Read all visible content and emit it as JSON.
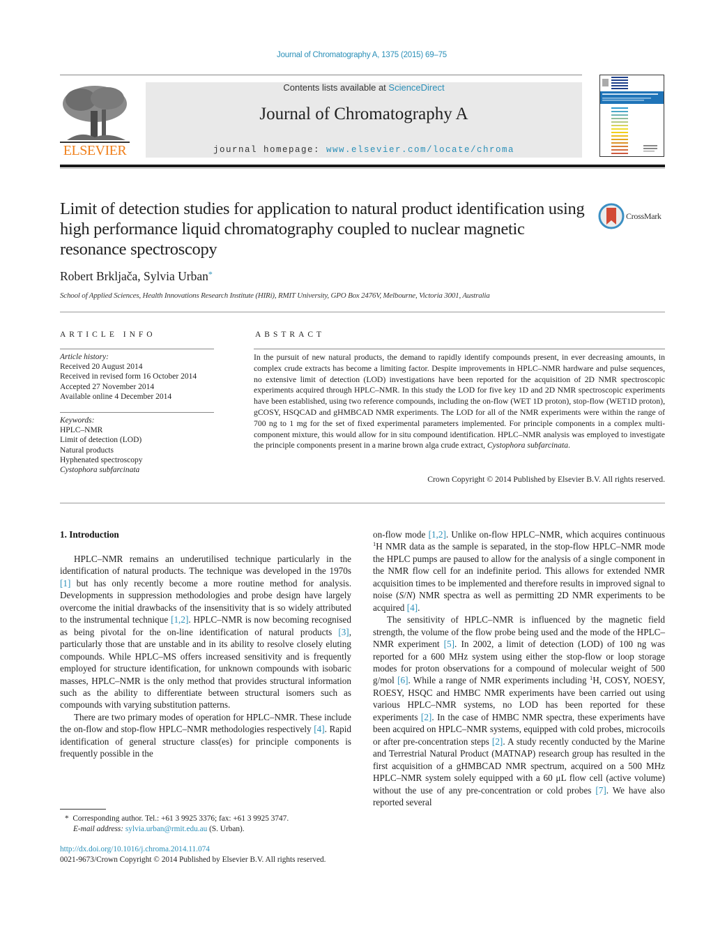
{
  "header": {
    "journal_ref": "Journal of Chromatography A, 1375 (2015) 69–75",
    "contents_prefix": "Contents lists available at ",
    "contents_link": "ScienceDirect",
    "journal_title": "Journal of Chromatography A",
    "homepage_prefix": "journal homepage: ",
    "homepage_link": "www.elsevier.com/locate/chroma",
    "publisher_logo_text": "ELSEVIER",
    "cover_alt": "journal-cover-thumbnail"
  },
  "colors": {
    "link": "#2a8fb8",
    "elsevier_orange": "#f07f1a",
    "masthead_bg": "#e9e9e9",
    "crossmark_red": "#d24a35",
    "crossmark_blue": "#3b8fc3"
  },
  "article": {
    "title": "Limit of detection studies for application to natural product identification using high performance liquid chromatography coupled to nuclear magnetic resonance spectroscopy",
    "crossmark_label": "CrossMark",
    "authors": "Robert Brkljača, Sylvia Urban",
    "author_mark": "*",
    "affiliation": "School of Applied Sciences, Health Innovations Research Institute (HIRi), RMIT University, GPO Box 2476V, Melbourne, Victoria 3001, Australia"
  },
  "article_info": {
    "heading": "ARTICLE INFO",
    "history_label": "Article history:",
    "history": [
      "Received 20 August 2014",
      "Received in revised form 16 October 2014",
      "Accepted 27 November 2014",
      "Available online 4 December 2014"
    ],
    "keywords_label": "Keywords:",
    "keywords": [
      "HPLC–NMR",
      "Limit of detection (LOD)",
      "Natural products",
      "Hyphenated spectroscopy",
      "Cystophora subfarcinata"
    ]
  },
  "abstract": {
    "heading": "ABSTRACT",
    "text_main": "In the pursuit of new natural products, the demand to rapidly identify compounds present, in ever decreasing amounts, in complex crude extracts has become a limiting factor. Despite improvements in HPLC–NMR hardware and pulse sequences, no extensive limit of detection (LOD) investigations have been reported for the acquisition of 2D NMR spectroscopic experiments acquired through HPLC–NMR. In this study the LOD for five key 1D and 2D NMR spectroscopic experiments have been established, using two reference compounds, including the on-flow (WET 1D proton), stop-flow (WET1D proton), gCOSY, HSQCAD and gHMBCAD NMR experiments. The LOD for all of the NMR experiments were within the range of 700 ng to 1 mg for the set of fixed experimental parameters implemented. For principle components in a complex multi-component mixture, this would allow for in situ compound identification. HPLC–NMR analysis was employed to investigate the principle components present in a marine brown alga crude extract, ",
    "text_species": "Cystophora subfarcinata",
    "text_end": ".",
    "copyright": "Crown Copyright © 2014 Published by Elsevier B.V. All rights reserved."
  },
  "body": {
    "section_heading": "1.  Introduction",
    "left_p1": [
      {
        "t": "HPLC–NMR remains an underutilised technique particularly in the identification of natural products. The technique was developed in the 1970s "
      },
      {
        "ref": "[1]"
      },
      {
        "t": " but has only recently become a more routine method for analysis. Developments in suppression methodologies and probe design have largely overcome the initial drawbacks of the insensitivity that is so widely attributed to the instrumental technique "
      },
      {
        "ref": "[1,2]"
      },
      {
        "t": ". HPLC–NMR is now becoming recognised as being pivotal for the on-line identification of natural products "
      },
      {
        "ref": "[3]"
      },
      {
        "t": ", particularly those that are unstable and in its ability to resolve closely eluting compounds. While HPLC–MS offers increased sensitivity and is frequently employed for structure identification, for unknown compounds with isobaric masses, HPLC–NMR is the only method that provides structural information such as the ability to differentiate between structural isomers such as compounds with varying substitution patterns."
      }
    ],
    "left_p2": [
      {
        "t": "There are two primary modes of operation for HPLC–NMR. These include the on-flow and stop-flow HPLC–NMR methodologies respectively "
      },
      {
        "ref": "[4]"
      },
      {
        "t": ". Rapid identification of general structure class(es) for principle components is frequently possible in the"
      }
    ],
    "right_p1": [
      {
        "t": "on-flow mode "
      },
      {
        "ref": "[1,2]"
      },
      {
        "t": ". Unlike on-flow HPLC–NMR, which acquires continuous "
      },
      {
        "sup": "1"
      },
      {
        "t": "H NMR data as the sample is separated, in the stop-flow HPLC–NMR mode the HPLC pumps are paused to allow for the analysis of a single component in the NMR flow cell for an indefinite period. This allows for extended NMR acquisition times to be implemented and therefore results in improved signal to noise ("
      },
      {
        "i": "S"
      },
      {
        "t": "/"
      },
      {
        "i": "N"
      },
      {
        "t": ") NMR spectra as well as permitting 2D NMR experiments to be acquired "
      },
      {
        "ref": "[4]"
      },
      {
        "t": "."
      }
    ],
    "right_p2": [
      {
        "t": "The sensitivity of HPLC–NMR is influenced by the magnetic field strength, the volume of the flow probe being used and the mode of the HPLC–NMR experiment "
      },
      {
        "ref": "[5]"
      },
      {
        "t": ". In 2002, a limit of detection (LOD) of 100 ng was reported for a 600 MHz system using either the stop-flow or loop storage modes for proton observations for a compound of molecular weight of 500 g/mol "
      },
      {
        "ref": "[6]"
      },
      {
        "t": ". While a range of NMR experiments including "
      },
      {
        "sup": "1"
      },
      {
        "t": "H, COSY, NOESY, ROESY, HSQC and HMBC NMR experiments have been carried out using various HPLC–NMR systems, no LOD has been reported for these experiments "
      },
      {
        "ref": "[2]"
      },
      {
        "t": ". In the case of HMBC NMR spectra, these experiments have been acquired on HPLC–NMR systems, equipped with cold probes, microcoils or after pre-concentration steps "
      },
      {
        "ref": "[2]"
      },
      {
        "t": ". A study recently conducted by the Marine and Terrestrial Natural Product (MATNAP) research group has resulted in the first acquisition of a gHMBCAD NMR spectrum, acquired on a 500 MHz HPLC–NMR system solely equipped with a 60 μL flow cell (active volume) without the use of any pre-concentration or cold probes "
      },
      {
        "ref": "[7]"
      },
      {
        "t": ". We have also reported several"
      }
    ]
  },
  "footnote": {
    "mark": "*",
    "corresponding": "Corresponding author. Tel.: +61 3 9925 3376; fax: +61 3 9925 3747.",
    "email_label": "E-mail address:",
    "email": "sylvia.urban@rmit.edu.au",
    "email_suffix": " (S. Urban).",
    "doi": "http://dx.doi.org/10.1016/j.chroma.2014.11.074",
    "issn_copyright": "0021-9673/Crown Copyright © 2014 Published by Elsevier B.V. All rights reserved."
  }
}
